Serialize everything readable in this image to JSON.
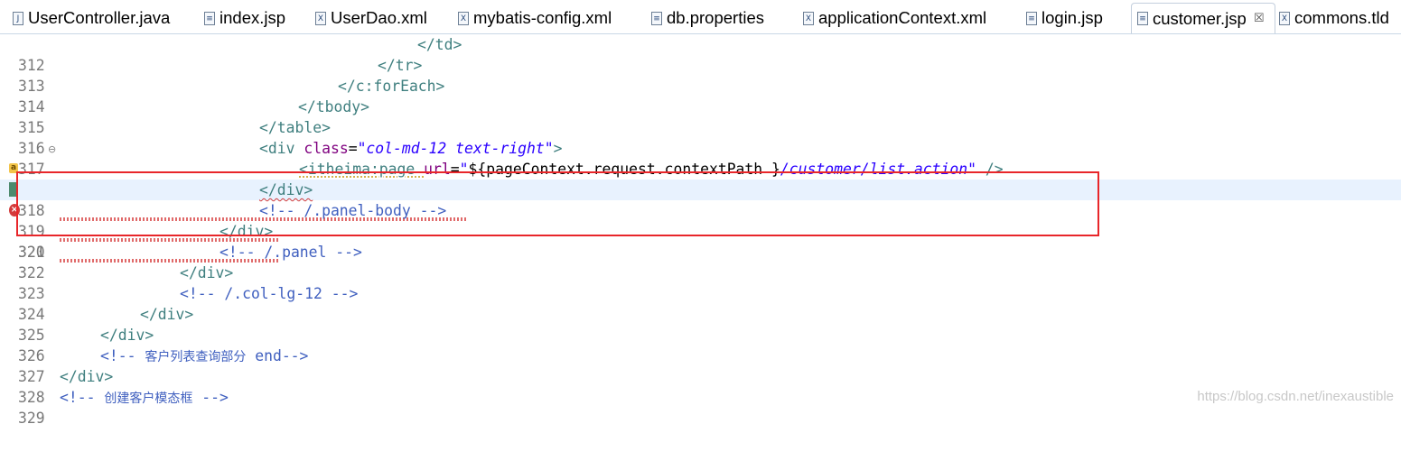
{
  "tabs": [
    {
      "label": "UserController.java",
      "icon": "java-file-icon",
      "glyph": "J"
    },
    {
      "label": "index.jsp",
      "icon": "jsp-file-icon",
      "glyph": "≡"
    },
    {
      "label": "UserDao.xml",
      "icon": "xml-file-icon",
      "glyph": "X"
    },
    {
      "label": "mybatis-config.xml",
      "icon": "xml-file-icon",
      "glyph": "X"
    },
    {
      "label": "db.properties",
      "icon": "properties-file-icon",
      "glyph": "≡"
    },
    {
      "label": "applicationContext.xml",
      "icon": "xml-file-icon",
      "glyph": "X"
    },
    {
      "label": "login.jsp",
      "icon": "jsp-file-icon",
      "glyph": "≡"
    },
    {
      "label": "customer.jsp",
      "icon": "jsp-file-icon",
      "glyph": "≡",
      "active": true,
      "close": "☒"
    },
    {
      "label": "commons.tld",
      "icon": "tld-file-icon",
      "glyph": "X"
    }
  ],
  "lines": [
    {
      "num": "312"
    },
    {
      "num": "313"
    },
    {
      "num": "314"
    },
    {
      "num": "315"
    },
    {
      "num": "316"
    },
    {
      "num": "317",
      "fold": "⊖"
    },
    {
      "num": "318"
    },
    {
      "num": "319"
    },
    {
      "num": "320"
    },
    {
      "num": "321"
    },
    {
      "num": "322"
    },
    {
      "num": "323"
    },
    {
      "num": "324"
    },
    {
      "num": "325"
    },
    {
      "num": "326"
    },
    {
      "num": "327"
    },
    {
      "num": "328"
    },
    {
      "num": "329"
    }
  ],
  "code": {
    "l312": "</td>",
    "l313": "</tr>",
    "l314": "</c:forEach>",
    "l315": "</tbody>",
    "l316": "</table>",
    "l317_open": "<div ",
    "l317_attr": "class",
    "l317_eq": "=",
    "l317_val": "\"col-md-12 text-right\"",
    "l317_close": ">",
    "l318_open": "<itheima:page ",
    "l318_attr": "url",
    "l318_eq": "=",
    "l318_q1": "\"",
    "l318_el": "${pageContext.request.contextPath }",
    "l318_path": "/customer/list.action\"",
    "l318_close": " />",
    "l319": "</div>",
    "l320": "<!-- /.panel-body -->",
    "l321": "</div>",
    "l322": "<!-- /.panel -->",
    "l323": "</div>",
    "l324": "<!-- /.col-lg-12 -->",
    "l325": "</div>",
    "l326": "</div>",
    "l327_a": "<!-- ",
    "l327_cjk": "客户列表查询部分",
    "l327_b": " end-->",
    "l328": "</div>",
    "l329_a": "<!-- ",
    "l329_cjk": "创建客户模态框",
    "l329_b": " -->"
  },
  "markers": {
    "warn": "a",
    "err": "×"
  },
  "watermark": "https://blog.csdn.net/inexaustible",
  "colors": {
    "tag": "#3f7f7f",
    "attr": "#7f007f",
    "string": "#2a00ff",
    "comment": "#3f5fbf",
    "highlight": "#e8262a",
    "current_line": "#e8f2fe"
  }
}
